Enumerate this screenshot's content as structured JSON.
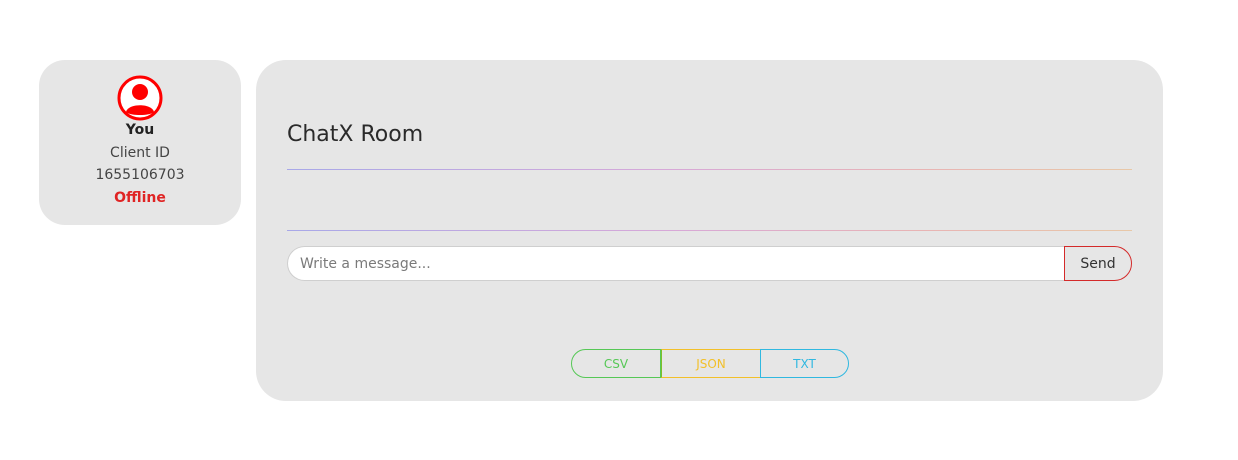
{
  "user_card": {
    "name": "You",
    "client_id_label": "Client ID",
    "client_id": "1655106703",
    "status": "Offline",
    "status_color": "#e02424",
    "avatar_icon": "user-circle-icon",
    "avatar_color": "#ff0000"
  },
  "chat": {
    "title": "ChatX Room",
    "messages": [],
    "input": {
      "value": "",
      "placeholder": "Write a message..."
    },
    "send_label": "Send"
  },
  "export": {
    "buttons": [
      {
        "label": "CSV",
        "color": "#56c856"
      },
      {
        "label": "JSON",
        "color": "#f2c02a"
      },
      {
        "label": "TXT",
        "color": "#30b8e0"
      }
    ]
  }
}
